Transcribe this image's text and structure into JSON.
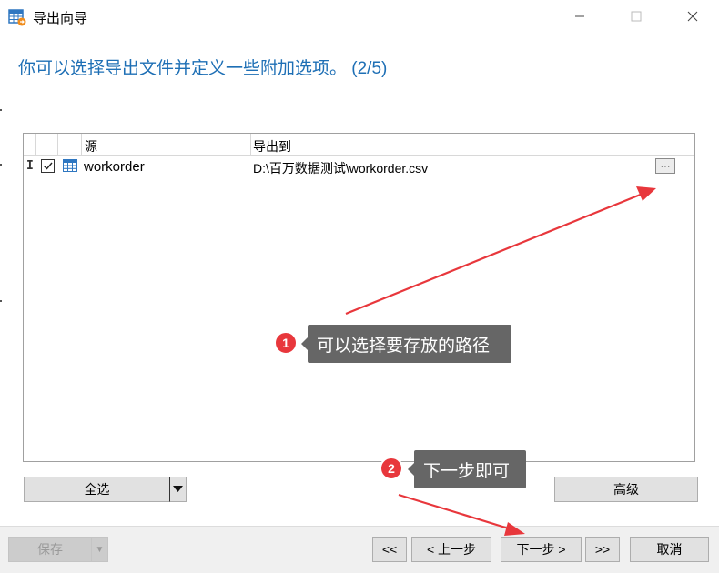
{
  "window": {
    "title": "导出向导",
    "controls": [
      "minimize",
      "maximize",
      "close"
    ]
  },
  "heading": "你可以选择导出文件并定义一些附加选项。 (2/5)",
  "grid": {
    "columns": [
      "源",
      "导出到"
    ],
    "rows": [
      {
        "checked": true,
        "icon": "table-icon",
        "source": "workorder",
        "target": "D:\\百万数据测试\\workorder.csv",
        "browse_label": "···"
      }
    ]
  },
  "buttons": {
    "select_all": "全选",
    "select_all_dropdown": "▼",
    "advanced": "高级",
    "save": "保存",
    "save_dropdown": "▼",
    "first": "<<",
    "prev": "< 上一步",
    "next": "下一步 >",
    "last": ">>",
    "cancel": "取消"
  },
  "annotations": [
    {
      "number": "1",
      "text": "可以选择要存放的路径",
      "color": "#e8373c"
    },
    {
      "number": "2",
      "text": "下一步即可",
      "color": "#e8373c"
    }
  ],
  "colors": {
    "heading": "#1e6fb5",
    "annotation_red": "#e8373c",
    "callout_bg": "#666666"
  }
}
